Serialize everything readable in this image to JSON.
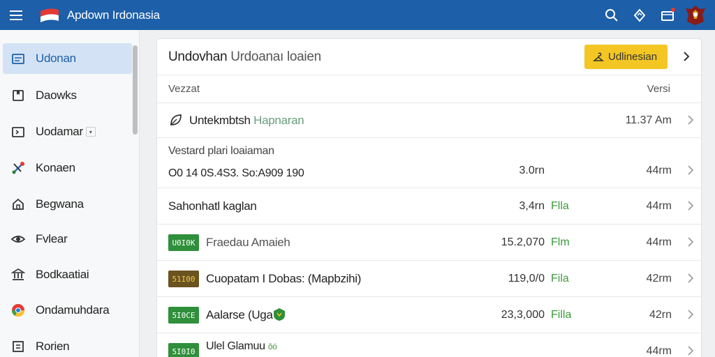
{
  "app": {
    "title": "Apdown Irdonasia"
  },
  "sidebar": {
    "items": [
      {
        "label": "Udonan",
        "icon": "calendar-icon",
        "active": true
      },
      {
        "label": "Daowks",
        "icon": "bookmark-box-icon"
      },
      {
        "label": "Uodamar",
        "icon": "folder-icon"
      },
      {
        "label": "Konaen",
        "icon": "tools-icon"
      },
      {
        "label": "Begwana",
        "icon": "home-icon"
      },
      {
        "label": "Fvlear",
        "icon": "eye-icon"
      },
      {
        "label": "Bodkaatiai",
        "icon": "bank-icon"
      },
      {
        "label": "Ondamuhdara",
        "icon": "chrome-icon"
      },
      {
        "label": "Rorien",
        "icon": "grid-icon"
      }
    ]
  },
  "header": {
    "title_main": "Undovhan",
    "title_muted": "Urdoanaı loaien",
    "button_label": "Udlinesian"
  },
  "columns": {
    "left": "Vezzat",
    "right": "Versi"
  },
  "rows": [
    {
      "title": "Untekmbtsh",
      "subtitle": "Hapnaran",
      "distance": "11.37 Am"
    },
    {
      "title": "Vestard plari loaiaman",
      "line2": "O0 14   0S.4S3.  So:A909 190",
      "amount": "3.0rn",
      "distance": "44rm"
    },
    {
      "title": "Sahonhatl kaglan",
      "amount": "3,4rn",
      "type": "Flla",
      "distance": "44rm"
    },
    {
      "tag": "U0I0K",
      "tag_color": "#2f8f3a",
      "title": "Fraedau Amaieh",
      "amount": "15.2,070",
      "type": "Flm",
      "distance": "44rm"
    },
    {
      "tag": "51I00",
      "tag_color": "#6b5320",
      "title": "Cuopatam I Dobas: (Mapbzihi)",
      "amount": "119,0/0",
      "type": "Fila",
      "distance": "42rm"
    },
    {
      "tag": "5I0CE",
      "tag_color": "#2f8f3a",
      "title": "Aalarse (Uga",
      "amount": "23,3,000",
      "type": "Filla",
      "distance": "42rn"
    },
    {
      "tag": "5I0I0",
      "tag_color": "#2f8f3a",
      "title": "Ulel Glamuu",
      "subtitle": "ŏó",
      "distance": "44rm"
    }
  ],
  "colors": {
    "topbar": "#1d5fa8",
    "accent_button": "#f3c623",
    "active_item": "#d3e3f5"
  }
}
